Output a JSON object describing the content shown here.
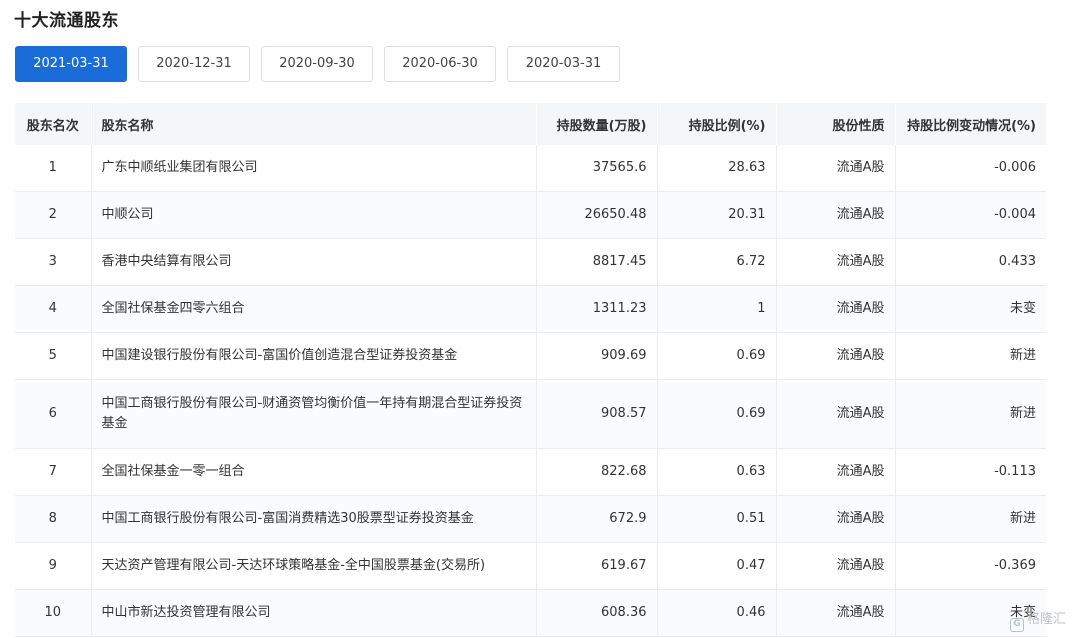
{
  "page": {
    "title": "十大流通股东"
  },
  "tabs": [
    {
      "label": "2021-03-31",
      "active": true
    },
    {
      "label": "2020-12-31",
      "active": false
    },
    {
      "label": "2020-09-30",
      "active": false
    },
    {
      "label": "2020-06-30",
      "active": false
    },
    {
      "label": "2020-03-31",
      "active": false
    }
  ],
  "table": {
    "headers": [
      "股东名次",
      "股东名称",
      "持股数量(万股)",
      "持股比例(%)",
      "股份性质",
      "持股比例变动情况(%)"
    ],
    "rows": [
      [
        "1",
        "广东中顺纸业集团有限公司",
        "37565.6",
        "28.63",
        "流通A股",
        "-0.006"
      ],
      [
        "2",
        "中顺公司",
        "26650.48",
        "20.31",
        "流通A股",
        "-0.004"
      ],
      [
        "3",
        "香港中央结算有限公司",
        "8817.45",
        "6.72",
        "流通A股",
        "0.433"
      ],
      [
        "4",
        "全国社保基金四零六组合",
        "1311.23",
        "1",
        "流通A股",
        "未变"
      ],
      [
        "5",
        "中国建设银行股份有限公司-富国价值创造混合型证券投资基金",
        "909.69",
        "0.69",
        "流通A股",
        "新进"
      ],
      [
        "6",
        "中国工商银行股份有限公司-财通资管均衡价值一年持有期混合型证券投资基金",
        "908.57",
        "0.69",
        "流通A股",
        "新进"
      ],
      [
        "7",
        "全国社保基金一零一组合",
        "822.68",
        "0.63",
        "流通A股",
        "-0.113"
      ],
      [
        "8",
        "中国工商银行股份有限公司-富国消费精选30股票型证券投资基金",
        "672.9",
        "0.51",
        "流通A股",
        "新进"
      ],
      [
        "9",
        "天达资产管理有限公司-天达环球策略基金-全中国股票基金(交易所)",
        "619.67",
        "0.47",
        "流通A股",
        "-0.369"
      ],
      [
        "10",
        "中山市新达投资管理有限公司",
        "608.36",
        "0.46",
        "流通A股",
        "未变"
      ]
    ]
  },
  "watermark": {
    "text": "格隆汇",
    "icon": "gelonghui-logo-icon"
  }
}
